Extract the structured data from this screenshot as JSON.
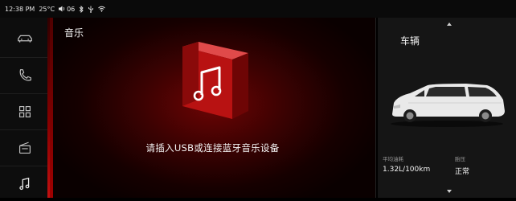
{
  "status_bar": {
    "time": "12:38 PM",
    "temperature": "25°C",
    "volume_level": "06",
    "icons": [
      "volume-icon",
      "bluetooth-icon",
      "usb-icon",
      "wifi-icon"
    ]
  },
  "sidebar": {
    "items": [
      {
        "name": "vehicle",
        "icon": "car-icon"
      },
      {
        "name": "phone",
        "icon": "phone-icon"
      },
      {
        "name": "apps",
        "icon": "grid-icon"
      },
      {
        "name": "radio",
        "icon": "radio-icon"
      },
      {
        "name": "music",
        "icon": "music-note-icon",
        "active": true
      }
    ]
  },
  "music": {
    "title": "音乐",
    "hint": "请插入USB或连接蓝牙音乐设备"
  },
  "vehicle": {
    "title": "车辆",
    "stats": [
      {
        "label": "平均油耗",
        "value": "1.32L/100km"
      },
      {
        "label": "胎压",
        "value": "正常"
      }
    ]
  },
  "colors": {
    "accent_red": "#c01010",
    "panel_bg": "#151515",
    "text": "#e8e8e8"
  }
}
